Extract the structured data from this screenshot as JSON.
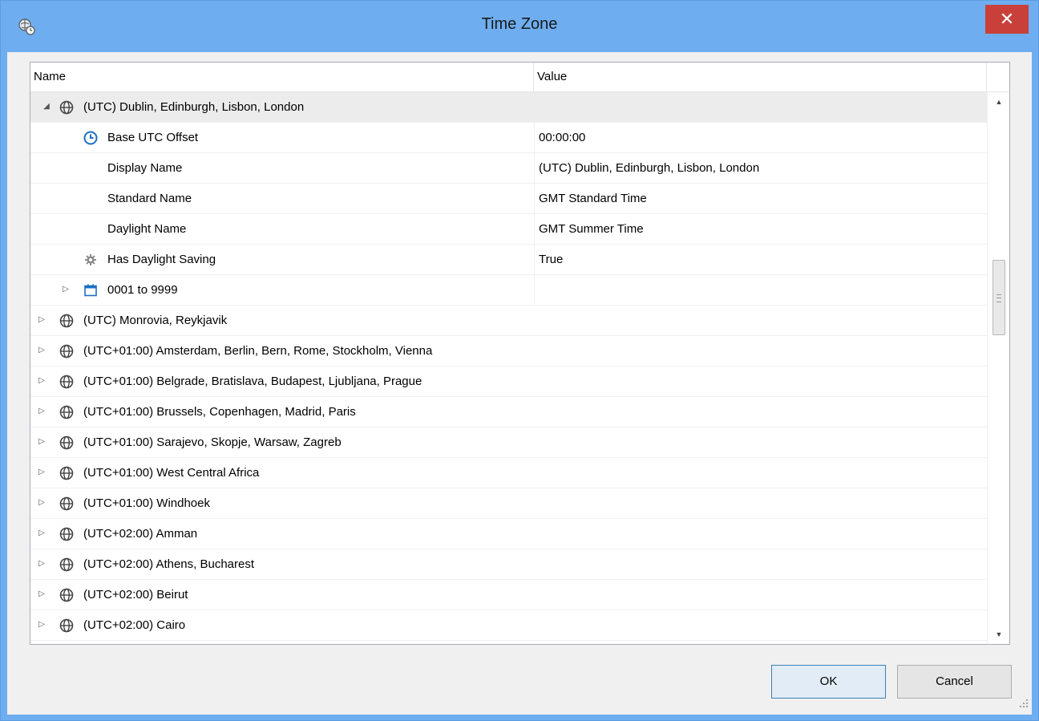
{
  "window": {
    "title": "Time Zone",
    "close_label": "✕"
  },
  "tree": {
    "columns": {
      "name": "Name",
      "value": "Value"
    },
    "root": {
      "label": "(UTC) Dublin, Edinburgh, Lisbon, London",
      "value": "",
      "children": [
        {
          "label": "Base UTC Offset",
          "value": "00:00:00",
          "icon": "clock-icon"
        },
        {
          "label": "Display Name",
          "value": "(UTC) Dublin, Edinburgh, Lisbon, London",
          "icon": ""
        },
        {
          "label": "Standard Name",
          "value": "GMT Standard Time",
          "icon": ""
        },
        {
          "label": "Daylight Name",
          "value": "GMT Summer Time",
          "icon": ""
        },
        {
          "label": "Has Daylight Saving",
          "value": "True",
          "icon": "gear-icon"
        },
        {
          "label": "0001 to 9999",
          "value": "",
          "icon": "calendar-icon"
        }
      ]
    },
    "zones": [
      "(UTC) Monrovia, Reykjavik",
      "(UTC+01:00) Amsterdam, Berlin, Bern, Rome, Stockholm, Vienna",
      "(UTC+01:00) Belgrade, Bratislava, Budapest, Ljubljana, Prague",
      "(UTC+01:00) Brussels, Copenhagen, Madrid, Paris",
      "(UTC+01:00) Sarajevo, Skopje, Warsaw, Zagreb",
      "(UTC+01:00) West Central Africa",
      "(UTC+01:00) Windhoek",
      "(UTC+02:00) Amman",
      "(UTC+02:00) Athens, Bucharest",
      "(UTC+02:00) Beirut",
      "(UTC+02:00) Cairo"
    ]
  },
  "buttons": {
    "ok": "OK",
    "cancel": "Cancel"
  },
  "colors": {
    "titlebar": "#6eaef0",
    "close": "#c9403a",
    "clock_icon": "#1b6fc4",
    "calendar_icon": "#1b6fc4"
  }
}
